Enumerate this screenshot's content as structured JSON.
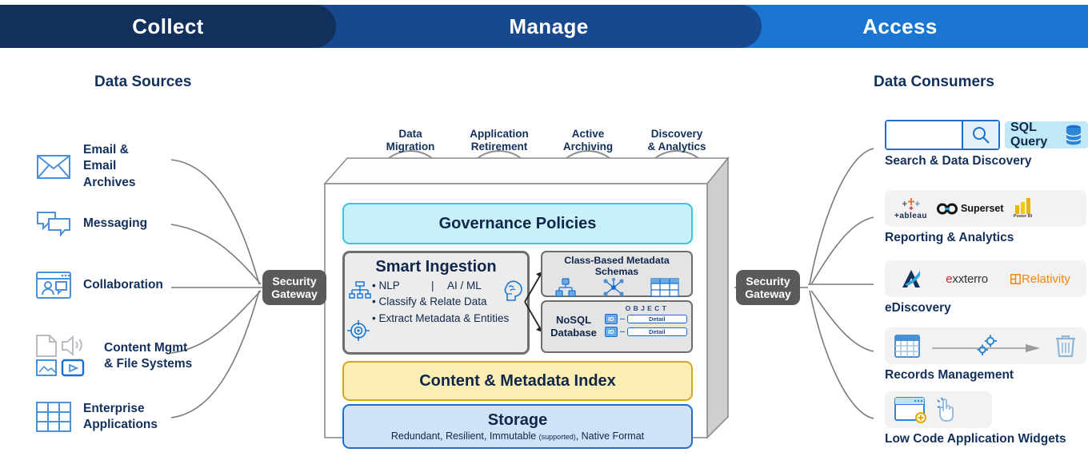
{
  "header": {
    "bands": [
      {
        "label": "Collect",
        "color": "#12305c"
      },
      {
        "label": "Manage",
        "color": "#18498f"
      },
      {
        "label": "Access",
        "color": "#1b76d2"
      }
    ]
  },
  "left": {
    "heading": "Data Sources",
    "gateway": {
      "line1": "Security",
      "line2": "Gateway"
    },
    "sources": [
      {
        "icon": "envelope-icon",
        "label": "Email &\nEmail\nArchives"
      },
      {
        "icon": "chat-bubbles-icon",
        "label": "Messaging"
      },
      {
        "icon": "collaboration-window-icon",
        "label": "Collaboration"
      },
      {
        "icon": "document-media-icon",
        "label": "Content Mgmt\n& File Systems"
      },
      {
        "icon": "table-grid-icon",
        "label": "Enterprise\nApplications"
      }
    ]
  },
  "center": {
    "arches": [
      {
        "line1": "Data",
        "line2": "Migration",
        "icon": "database-cloud-upload-icon"
      },
      {
        "line1": "Application",
        "line2": "Retirement",
        "icon": "window-prohibited-icon"
      },
      {
        "line1": "Active",
        "line2": "Archiving",
        "icon": "database-cloud-stream-icon"
      },
      {
        "line1": "Discovery",
        "line2": "& Analytics",
        "icon": "document-magnifier-icon"
      }
    ],
    "governance": {
      "title": "Governance Policies"
    },
    "smart_ingestion": {
      "title": "Smart Ingestion",
      "row1_left": "NLP",
      "row1_divider": "|",
      "row1_right": "AI / ML",
      "bullet2": "Classify & Relate Data",
      "bullet3": "Extract Metadata & Entities"
    },
    "class_schemas": {
      "title": "Class-Based Metadata Schemas"
    },
    "nosql": {
      "line1": "NoSQL",
      "line2": "Database",
      "object_header": "O B J E C T",
      "rows": [
        {
          "id": "ID",
          "detail": "Detail"
        },
        {
          "id": "ID",
          "detail": "Detail"
        }
      ]
    },
    "index": {
      "title": "Content & Metadata Index"
    },
    "storage": {
      "title": "Storage",
      "subtitle_a": "Redundant, Resilient, Immutable ",
      "subtitle_small": "(supported)",
      "subtitle_b": ", Native Format"
    },
    "gateway": {
      "line1": "Security",
      "line2": "Gateway"
    }
  },
  "right": {
    "heading": "Data Consumers",
    "consumers": [
      {
        "label": "Search & Data Discovery",
        "kind": "search",
        "search_value": "",
        "badge": "SQL Query"
      },
      {
        "label": "Reporting & Analytics",
        "kind": "logos",
        "logos": [
          "+ableau",
          "Superset",
          "Power BI"
        ]
      },
      {
        "label": "eDiscovery",
        "kind": "logos",
        "logos": [
          "A",
          "exterro",
          "Relativity"
        ]
      },
      {
        "label": "Records Management",
        "kind": "icons",
        "icons": [
          "calendar-icon",
          "gears-icon",
          "trash-icon"
        ]
      },
      {
        "label": "Low Code Application Widgets",
        "kind": "icons",
        "icons": [
          "window-plus-icon",
          "tap-hand-icon"
        ]
      }
    ]
  },
  "colors": {
    "navy": "#12305c",
    "blue": "#1b76d2",
    "icon_blue": "#4a90d9",
    "cyan_fill": "#c8f0f9",
    "yellow_fill": "#faeeb4",
    "storage_fill": "#cfe2f7",
    "gray_panel": "#e4e4e4",
    "gateway_gray": "#5a5a5a",
    "orange": "#f2870d",
    "wire": "#7a7a7a"
  }
}
